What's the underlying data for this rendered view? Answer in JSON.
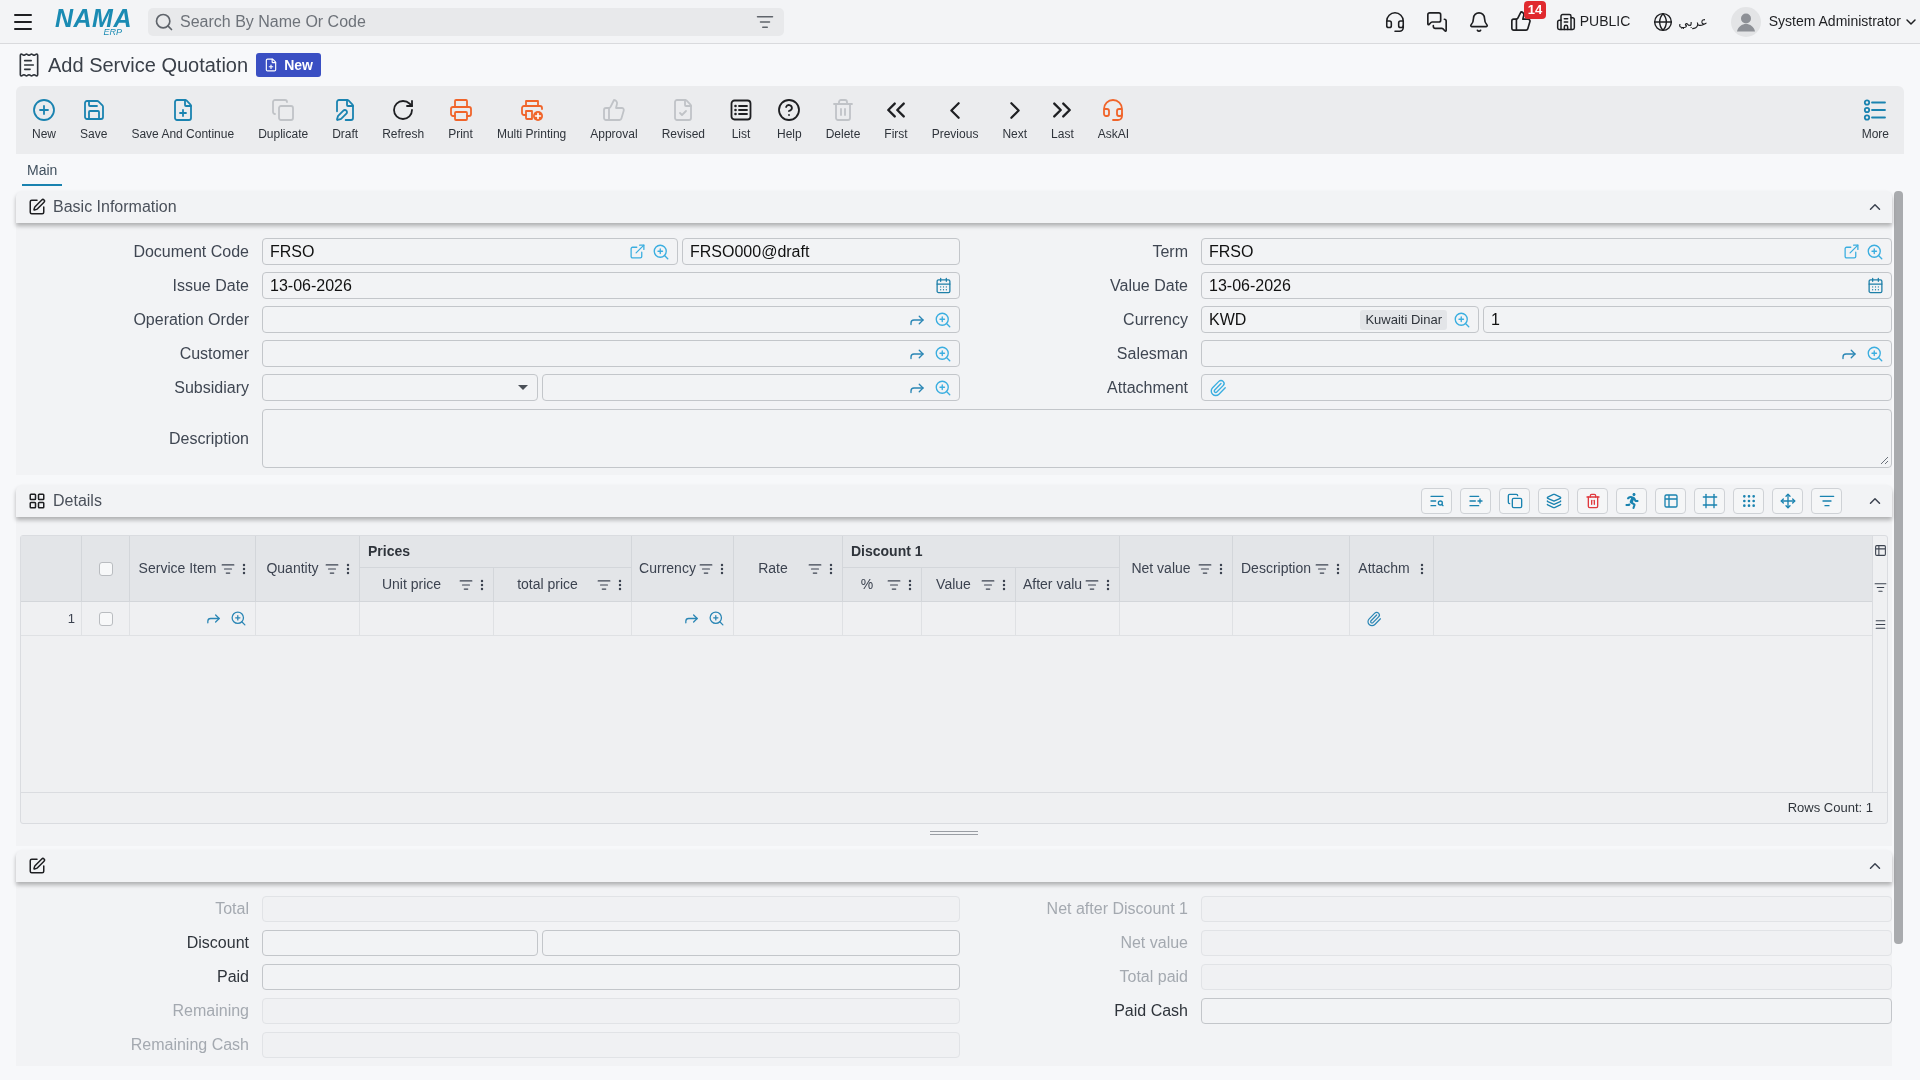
{
  "top_bar": {
    "logo": {
      "text": "NAMA",
      "subtext": "ERP"
    },
    "search": {
      "placeholder": "Search By Name Or Code"
    },
    "likes_badge": "14",
    "branch": "PUBLIC",
    "language": "عربي",
    "user": "System Administrator"
  },
  "page_header": {
    "title": "Add Service Quotation",
    "status": "New"
  },
  "toolbar": {
    "buttons": [
      {
        "label": "New",
        "disabled": false
      },
      {
        "label": "Save",
        "disabled": false
      },
      {
        "label": "Save And Continue",
        "disabled": false
      },
      {
        "label": "Duplicate",
        "disabled": true
      },
      {
        "label": "Draft",
        "disabled": false
      },
      {
        "label": "Refresh",
        "disabled": false
      },
      {
        "label": "Print",
        "disabled": false
      },
      {
        "label": "Multi Printing",
        "disabled": false
      },
      {
        "label": "Approval",
        "disabled": true
      },
      {
        "label": "Revised",
        "disabled": true
      },
      {
        "label": "List",
        "disabled": false
      },
      {
        "label": "Help",
        "disabled": false
      },
      {
        "label": "Delete",
        "disabled": true
      },
      {
        "label": "First",
        "disabled": false
      },
      {
        "label": "Previous",
        "disabled": false
      },
      {
        "label": "Next",
        "disabled": false
      },
      {
        "label": "Last",
        "disabled": false
      },
      {
        "label": "AskAI",
        "disabled": false
      }
    ],
    "more": "More"
  },
  "tabs": [
    {
      "label": "Main",
      "selected": true
    }
  ],
  "basic_information": {
    "title": "Basic Information",
    "expanded": true,
    "left_fields": [
      {
        "label": "Document Code",
        "kind": "code",
        "value": "FRSO",
        "code": "FRSO000@draft"
      },
      {
        "label": "Issue Date",
        "kind": "date",
        "value": "13-06-2026"
      },
      {
        "label": "Operation Order",
        "kind": "lookup"
      },
      {
        "label": "Customer",
        "kind": "lookup"
      },
      {
        "label": "Subsidiary",
        "kind": "select_lookup"
      }
    ],
    "right_fields": [
      {
        "label": "Term",
        "kind": "code",
        "value": "FRSO"
      },
      {
        "label": "Value Date",
        "kind": "date",
        "value": "13-06-2026"
      },
      {
        "label": "Currency",
        "kind": "currency",
        "value": "KWD",
        "currency_name": "Kuwaiti Dinar",
        "rate": "1"
      },
      {
        "label": "Salesman",
        "kind": "lookup"
      },
      {
        "label": "Attachment",
        "kind": "attachment"
      }
    ],
    "description": {
      "label": "Description"
    }
  },
  "details": {
    "title": "Details",
    "expanded": true,
    "table": {
      "all_selected": false,
      "columns": [
        {
          "label": "Service Item",
          "kind": "lookup",
          "filter": true
        },
        {
          "label": "Quantity",
          "filter": true
        },
        {
          "group": "Prices",
          "children": [
            {
              "label": "Unit price",
              "filter": true
            },
            {
              "label": "total price",
              "filter": true
            }
          ]
        },
        {
          "label": "Currency",
          "kind": "lookup",
          "filter": true
        },
        {
          "label": "Rate",
          "filter": true
        },
        {
          "group": "Discount 1",
          "children": [
            {
              "label": "%",
              "filter": true
            },
            {
              "label": "Value",
              "filter": true
            },
            {
              "label": "After valu",
              "filter": true
            }
          ]
        },
        {
          "label": "Net value",
          "filter": true
        },
        {
          "label": "Description",
          "filter": true
        },
        {
          "label": "Attachm",
          "kind": "attachment",
          "filter": false
        }
      ],
      "rows": [
        {
          "number": "1",
          "selected": false
        }
      ],
      "rows_count": "Rows Count: 1"
    }
  },
  "summary": {
    "expanded": true,
    "left_fields": [
      {
        "label": "Total",
        "kind": "single",
        "disabled": true
      },
      {
        "label": "Discount",
        "kind": "double",
        "disabled": false
      },
      {
        "label": "Paid",
        "kind": "single",
        "disabled": false
      },
      {
        "label": "Remaining",
        "kind": "single",
        "disabled": true
      },
      {
        "label": "Remaining Cash",
        "kind": "single",
        "disabled": true
      }
    ],
    "right_fields": [
      {
        "label": "Net after Discount 1",
        "kind": "single",
        "disabled": true
      },
      {
        "label": "Net value",
        "kind": "single",
        "disabled": true
      },
      {
        "label": "Total paid",
        "kind": "single",
        "disabled": true
      },
      {
        "label": "Paid Cash",
        "kind": "single",
        "disabled": false
      }
    ]
  }
}
